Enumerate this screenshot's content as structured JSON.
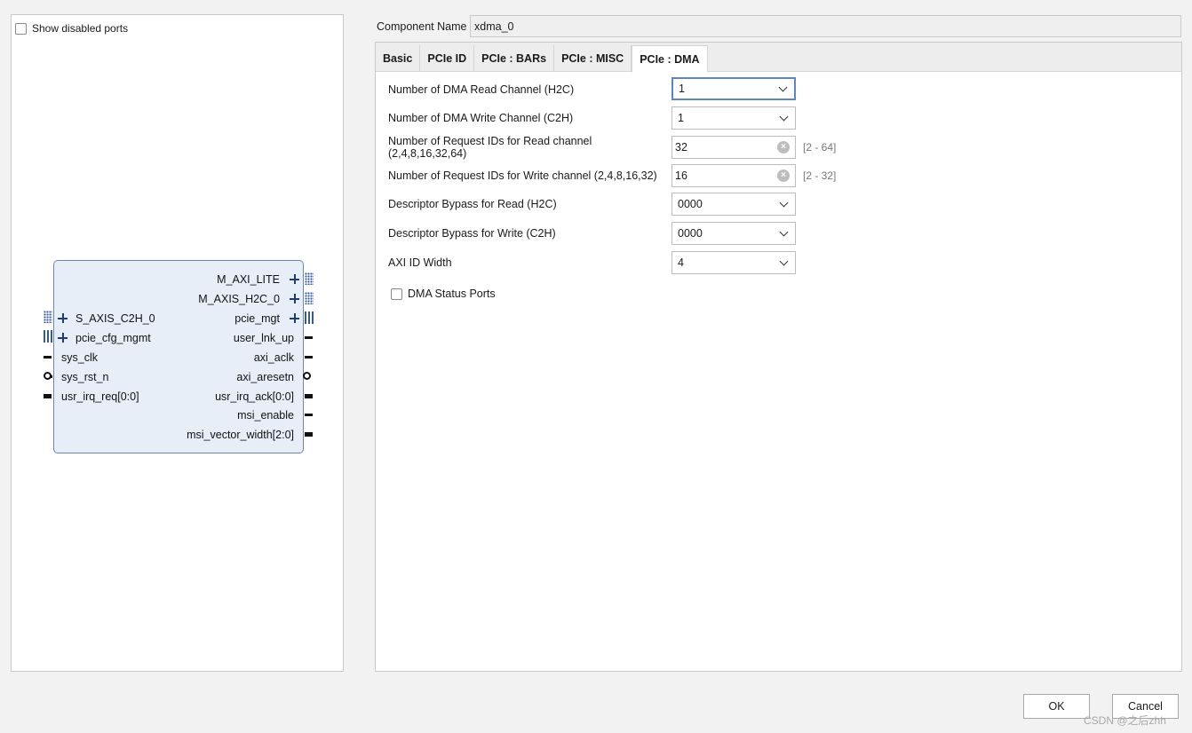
{
  "left": {
    "show_disabled_label": "Show disabled ports",
    "ports_right": [
      "M_AXI_LITE",
      "M_AXIS_H2C_0",
      "pcie_mgt",
      "user_lnk_up",
      "axi_aclk",
      "axi_aresetn",
      "usr_irq_ack[0:0]",
      "msi_enable",
      "msi_vector_width[2:0]"
    ],
    "ports_left": [
      "S_AXIS_C2H_0",
      "pcie_cfg_mgmt",
      "sys_clk",
      "sys_rst_n",
      "usr_irq_req[0:0]"
    ]
  },
  "component": {
    "label": "Component Name",
    "value": "xdma_0"
  },
  "tabs": [
    "Basic",
    "PCIe ID",
    "PCIe : BARs",
    "PCIe : MISC",
    "PCIe : DMA"
  ],
  "form": {
    "read_channels": {
      "label": "Number of DMA Read Channel (H2C)",
      "value": "1"
    },
    "write_channels": {
      "label": "Number of DMA Write Channel (C2H)",
      "value": "1"
    },
    "req_ids_read": {
      "label": "Number of Request IDs for Read channel (2,4,8,16,32,64)",
      "value": "32",
      "range": "[2 - 64]"
    },
    "req_ids_write": {
      "label": "Number of Request IDs for Write channel (2,4,8,16,32)",
      "value": "16",
      "range": "[2 - 32]"
    },
    "bypass_read": {
      "label": "Descriptor Bypass for Read (H2C)",
      "value": "0000"
    },
    "bypass_write": {
      "label": "Descriptor Bypass for Write (C2H)",
      "value": "0000"
    },
    "axi_id_width": {
      "label": "AXI ID Width",
      "value": "4"
    },
    "status_ports_label": "DMA Status Ports"
  },
  "buttons": {
    "ok": "OK",
    "cancel": "Cancel"
  },
  "watermark": "CSDN @之后zhh"
}
